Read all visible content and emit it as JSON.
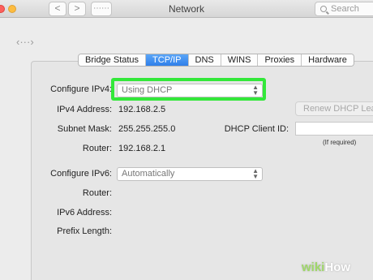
{
  "window": {
    "title": "Network",
    "search_placeholder": "Search",
    "back_label": "<",
    "forward_label": ">",
    "grid_label": "⋯⋯",
    "back_all_glyph": "‹···›"
  },
  "tabs": [
    {
      "label": "Bridge Status",
      "active": false
    },
    {
      "label": "TCP/IP",
      "active": true
    },
    {
      "label": "DNS",
      "active": false
    },
    {
      "label": "WINS",
      "active": false
    },
    {
      "label": "Proxies",
      "active": false
    },
    {
      "label": "Hardware",
      "active": false
    }
  ],
  "ipv4": {
    "configure_label": "Configure IPv4:",
    "configure_value": "Using DHCP",
    "address_label": "IPv4 Address:",
    "address_value": "192.168.2.5",
    "subnet_label": "Subnet Mask:",
    "subnet_value": "255.255.255.0",
    "router_label": "Router:",
    "router_value": "192.168.2.1",
    "renew_button": "Renew DHCP Lease",
    "client_id_label": "DHCP Client ID:",
    "client_id_value": "",
    "client_id_hint": "(If required)"
  },
  "ipv6": {
    "configure_label": "Configure IPv6:",
    "configure_value": "Automatically",
    "router_label": "Router:",
    "address_label": "IPv6 Address:",
    "prefix_label": "Prefix Length:"
  },
  "watermark": {
    "wiki": "wiki",
    "how": "How"
  },
  "colors": {
    "highlight": "#33e83a",
    "tab_active": "#2f7fe9"
  }
}
